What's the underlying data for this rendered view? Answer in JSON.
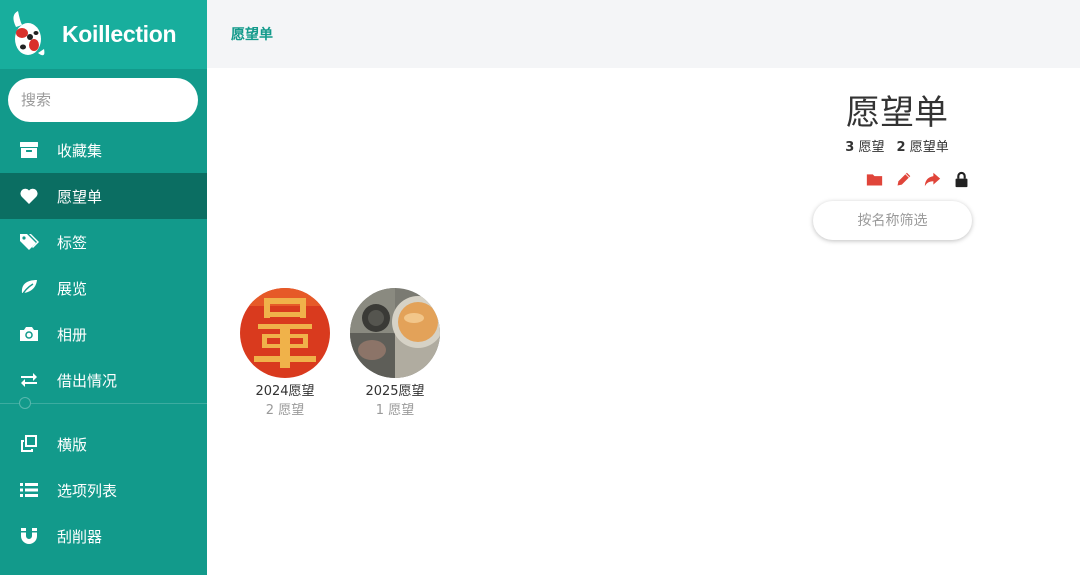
{
  "app": {
    "name": "Koillection"
  },
  "search": {
    "placeholder": "搜索"
  },
  "sidebar": {
    "items": [
      {
        "label": "收藏集",
        "icon": "archive-icon"
      },
      {
        "label": "愿望单",
        "icon": "heart-icon",
        "active": true
      },
      {
        "label": "标签",
        "icon": "tags-icon"
      },
      {
        "label": "展览",
        "icon": "leaf-icon"
      },
      {
        "label": "相册",
        "icon": "camera-icon"
      },
      {
        "label": "借出情况",
        "icon": "exchange-icon"
      }
    ],
    "items2": [
      {
        "label": "横版",
        "icon": "clone-icon"
      },
      {
        "label": "选项列表",
        "icon": "list-icon"
      },
      {
        "label": "刮削器",
        "icon": "magnet-icon"
      }
    ]
  },
  "topbar": {
    "breadcrumb": "愿望单"
  },
  "main": {
    "title": "愿望单",
    "stats": {
      "wishes_count": "3",
      "wishes_label": "愿望",
      "wishlists_count": "2",
      "wishlists_label": "愿望单"
    },
    "filter_placeholder": "按名称筛选",
    "wishlists": [
      {
        "name": "2024愿望",
        "count": "2 愿望"
      },
      {
        "name": "2025愿望",
        "count": "1 愿望"
      }
    ]
  },
  "colors": {
    "accent": "#129a8b",
    "brand_bar": "#18ae9d",
    "active": "#0b6e62",
    "action_icon": "#e0453a"
  }
}
